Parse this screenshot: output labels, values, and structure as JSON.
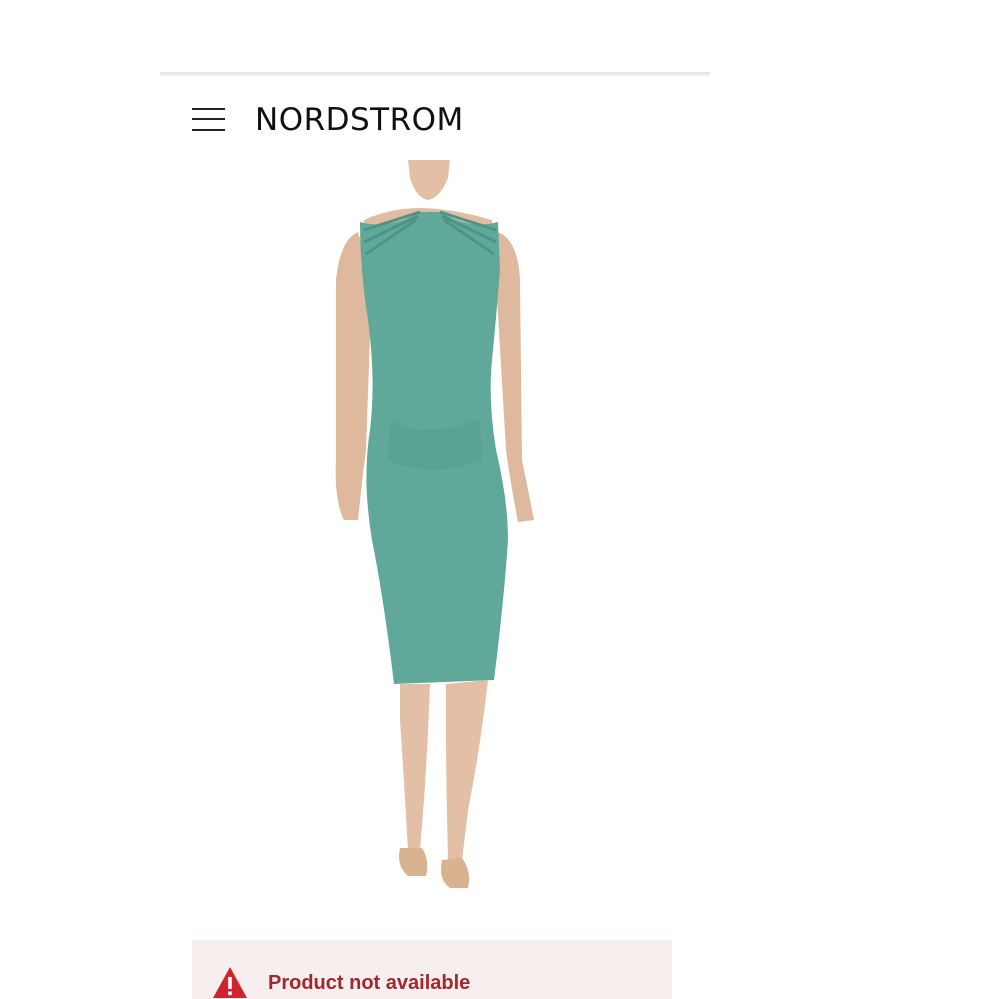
{
  "header": {
    "logo_text": "NORDSTROM",
    "menu_icon": "hamburger-menu-icon"
  },
  "product": {
    "image_alt": "Teal sleeveless midi dress with strappy shoulder cutouts",
    "dress_color": "#5fa89a"
  },
  "alert": {
    "icon": "warning-triangle-icon",
    "message": "Product not available",
    "text_color": "#a3272e",
    "background_color": "#f7efee"
  }
}
